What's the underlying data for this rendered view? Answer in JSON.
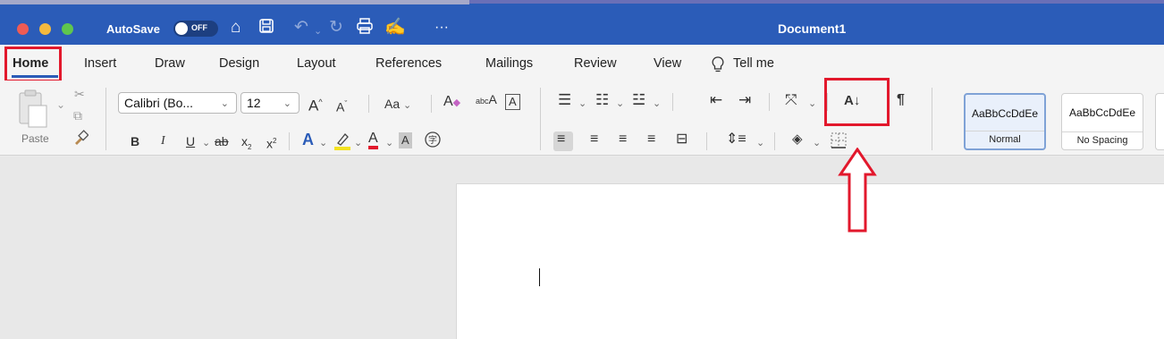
{
  "title_bar": {
    "autosave_label": "AutoSave",
    "autosave_state": "OFF",
    "document_title": "Document1",
    "more_label": "···"
  },
  "tabs": [
    {
      "label": "Home",
      "active": true
    },
    {
      "label": "Insert"
    },
    {
      "label": "Draw"
    },
    {
      "label": "Design"
    },
    {
      "label": "Layout"
    },
    {
      "label": "References"
    },
    {
      "label": "Mailings"
    },
    {
      "label": "Review"
    },
    {
      "label": "View"
    },
    {
      "label": "Tell me"
    }
  ],
  "ribbon": {
    "paste_label": "Paste",
    "font_name": "Calibri (Bo...",
    "font_size": "12",
    "grow_font": "A",
    "shrink_font": "A",
    "change_case": "Aa",
    "bold": "B",
    "italic": "I",
    "underline": "U",
    "strikethrough": "ab",
    "subscript": "x",
    "superscript": "x",
    "text_effects": "A",
    "font_color": "A",
    "char_shading": "A",
    "sort": "A↓",
    "pilcrow": "¶",
    "styles": [
      {
        "sample": "AaBbCcDdEe",
        "name": "Normal",
        "selected": true
      },
      {
        "sample": "AaBbCcDdEe",
        "name": "No Spacing",
        "selected": false
      }
    ]
  },
  "colors": {
    "title_bar": "#2b5cb8",
    "highlight_box": "#e2182c",
    "highlight_color_swatch": "#f3e21f",
    "font_color_swatch": "#e2182c"
  }
}
